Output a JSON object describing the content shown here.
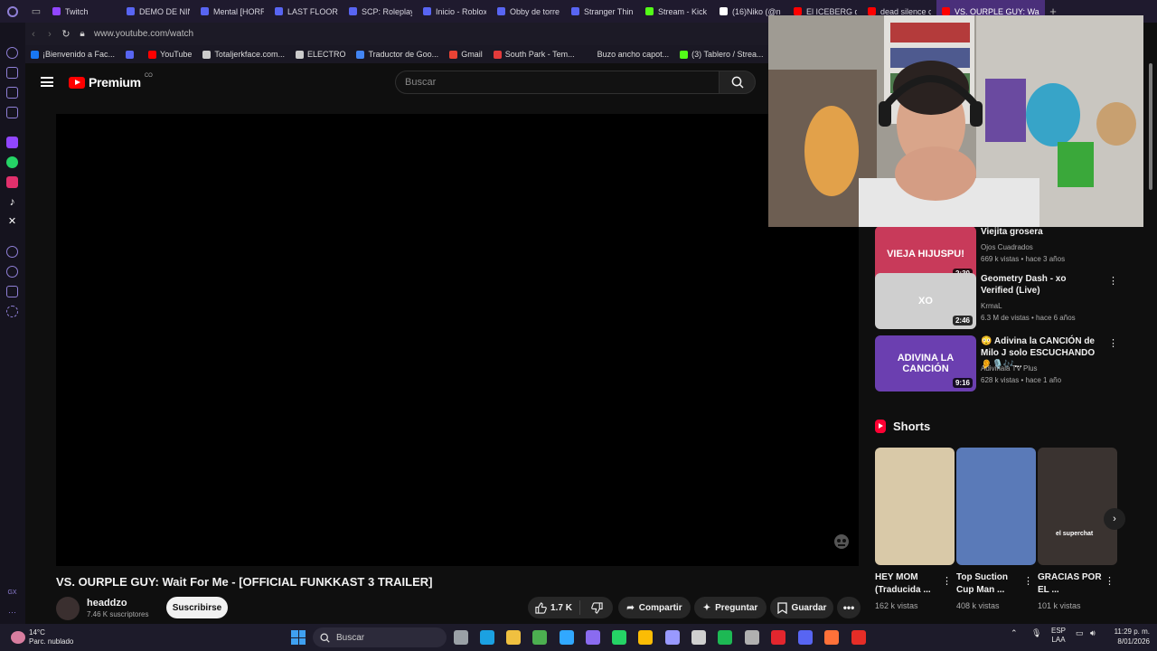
{
  "browser": {
    "tabs": [
      {
        "label": "Twitch",
        "color": "#9146ff"
      },
      {
        "label": "DEMO DE NIN",
        "color": "#5865f2"
      },
      {
        "label": "Mental [HORR",
        "color": "#5865f2"
      },
      {
        "label": "LAST FLOOR",
        "color": "#5865f2"
      },
      {
        "label": "SCP: Roleplay",
        "color": "#5865f2"
      },
      {
        "label": "Inicio - Roblox",
        "color": "#5865f2"
      },
      {
        "label": "Obby de torre",
        "color": "#5865f2"
      },
      {
        "label": "Stranger Thin",
        "color": "#5865f2"
      },
      {
        "label": "Stream - Kick",
        "color": "#53fc18"
      },
      {
        "label": "(16)Niko (@n",
        "color": "#ffffff"
      },
      {
        "label": "El ICEBERG d",
        "color": "#ff0000"
      },
      {
        "label": "dead silence c",
        "color": "#ff0000"
      },
      {
        "label": "VS. OURPLE GUY: Wait F",
        "color": "#ff0000",
        "active": true
      }
    ],
    "new_tab": "+",
    "url": "www.youtube.com/watch",
    "bookmarks": [
      {
        "label": "¡Bienvenido a Fac...",
        "color": "#1877f2"
      },
      {
        "label": "",
        "color": "#5865f2"
      },
      {
        "label": "YouTube",
        "color": "#ff0000"
      },
      {
        "label": "Totaljerkface.com...",
        "color": "#cccccc"
      },
      {
        "label": "ELECTRO",
        "color": "#cccccc"
      },
      {
        "label": "Traductor de Goo...",
        "color": "#4285f4"
      },
      {
        "label": "Gmail",
        "color": "#ea4335"
      },
      {
        "label": "South Park - Tem...",
        "color": "#e33b3b"
      },
      {
        "label": "Buzo ancho capot...",
        "color": "#1a1824"
      },
      {
        "label": "(3) Tablero / Strea...",
        "color": "#53fc18"
      }
    ]
  },
  "youtube": {
    "logo_text": "Premium",
    "country_code": "CO",
    "search_placeholder": "Buscar",
    "video_title": "VS. OURPLE GUY: Wait For Me - [OFFICIAL FUNKKAST 3 TRAILER]",
    "channel": {
      "name": "headdzo",
      "subscribers": "7.46 K suscriptores"
    },
    "subscribe_label": "Suscribirse",
    "actions": {
      "likes": "1.7 K",
      "share": "Compartir",
      "ask": "Preguntar",
      "save": "Guardar",
      "more": "•••"
    },
    "recommendations": [
      {
        "title": "Viejita grosera",
        "channel": "Ojos Cuadrados",
        "meta": "669 k vistas • hace 3 años",
        "duration": "2:30",
        "thumb_color": "#c83a5a",
        "thumb_text": "VIEJA HIJUSPU!"
      },
      {
        "title": "Geometry Dash - xo Verified (Live)",
        "channel": "KrmaL",
        "verified": true,
        "meta": "6.3 M de vistas • hace 6 años",
        "duration": "2:46",
        "thumb_color": "#cfcfcf",
        "thumb_text": "XO"
      },
      {
        "title": "😳 Adivina la CANCIÓN de Milo J solo ESCUCHANDO 👂🎙️🎶...",
        "channel": "Adivinala TV Plus",
        "meta": "628 k vistas • hace 1 año",
        "duration": "9:16",
        "thumb_color": "#6b3fb0",
        "thumb_text": "ADIVINA LA CANCIÓN"
      }
    ],
    "menu_glyph": "⋮",
    "shorts": {
      "heading": "Shorts",
      "items": [
        {
          "title": "HEY MOM (Traducida ...",
          "views": "162 k vistas",
          "color": "#d9c9a8"
        },
        {
          "title": "Top Suction Cup Man ...",
          "views": "408 k vistas",
          "color": "#5a7ab8"
        },
        {
          "title": "GRACIAS POR EL ...",
          "views": "101 k vistas",
          "color": "#3a3330",
          "overlay": "el superchat"
        }
      ]
    }
  },
  "taskbar": {
    "weather": {
      "temp": "14°C",
      "desc": "Parc. nublado"
    },
    "search_placeholder": "Buscar",
    "language": {
      "line1": "ESP",
      "line2": "LAA"
    },
    "clock": {
      "time": "11:29 p. m.",
      "date": "8/01/2026"
    },
    "apps": [
      {
        "name": "task-view-icon",
        "color": "#9aa0a6"
      },
      {
        "name": "edge-icon",
        "color": "#1ba1e2"
      },
      {
        "name": "file-explorer-icon",
        "color": "#f0c040"
      },
      {
        "name": "minecraft-icon",
        "color": "#4caf50"
      },
      {
        "name": "photoshop-icon",
        "color": "#31a8ff"
      },
      {
        "name": "copilot-icon",
        "color": "#8a6bf0"
      },
      {
        "name": "whatsapp-icon",
        "color": "#25d366"
      },
      {
        "name": "chrome-icon",
        "color": "#fbbc05"
      },
      {
        "name": "premiere-icon",
        "color": "#9999ff"
      },
      {
        "name": "store-icon",
        "color": "#cfcfcf"
      },
      {
        "name": "spotify-icon",
        "color": "#1db954"
      },
      {
        "name": "steam-icon",
        "color": "#b0b0b0"
      },
      {
        "name": "opera-icon",
        "color": "#e3262e"
      },
      {
        "name": "discord-icon",
        "color": "#5865f2"
      },
      {
        "name": "firefox-icon",
        "color": "#ff7139"
      },
      {
        "name": "media-app-icon",
        "color": "#e52d27"
      }
    ]
  }
}
